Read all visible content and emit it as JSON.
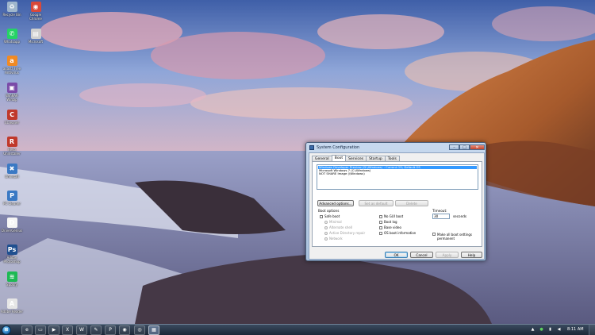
{
  "desktop": {
    "icons": [
      {
        "label": "Recycle Bin",
        "icon": "recycle-bin-icon",
        "glyph": "♻",
        "color": "#9fb6cc"
      },
      {
        "label": "Google Chrome",
        "icon": "chrome-icon",
        "glyph": "◉",
        "color": "#d9493a"
      },
      {
        "label": "Whatsapp",
        "icon": "whatsapp-icon",
        "glyph": "✆",
        "color": "#25d366"
      },
      {
        "label": "Microsoft",
        "icon": "document-icon",
        "glyph": "▤",
        "color": "#d0d0d0"
      },
      {
        "label": "avast! Free Antivirus",
        "icon": "avast-icon",
        "glyph": "a",
        "color": "#f08a24"
      },
      {
        "label": "WinRAR Winzip",
        "icon": "archive-icon",
        "glyph": "▣",
        "color": "#7a4ba8"
      },
      {
        "label": "CCleaner",
        "icon": "ccleaner-icon",
        "glyph": "C",
        "color": "#c0392b"
      },
      {
        "label": "Revo Uninstaller",
        "icon": "uninstaller-icon",
        "glyph": "R",
        "color": "#c0392b"
      },
      {
        "label": "Uninstall",
        "icon": "uninstall-icon",
        "glyph": "✖",
        "color": "#3a79c4"
      },
      {
        "label": "PC Cleaner",
        "icon": "cleaner-icon",
        "glyph": "P",
        "color": "#3a79c4"
      },
      {
        "label": "DriverGenius",
        "icon": "driver-icon",
        "glyph": "D",
        "color": "#f5f5f5"
      },
      {
        "label": "Adobe Photoshop",
        "icon": "photoshop-icon",
        "glyph": "Ps",
        "color": "#1f4f8f"
      },
      {
        "label": "Spotify",
        "icon": "spotify-icon",
        "glyph": "≋",
        "color": "#1db954"
      },
      {
        "label": "Adobe Reader",
        "icon": "pdf-icon",
        "glyph": "A",
        "color": "#e6e6e6"
      }
    ]
  },
  "dialog": {
    "title": "System Configuration",
    "caption": {
      "minimize": "–",
      "maximize": "□",
      "close": "✕"
    },
    "tabs": [
      "General",
      "Boot",
      "Services",
      "Startup",
      "Tools"
    ],
    "active_tab": "Boot",
    "os_list": [
      "Windows Developer Preview (D:\\Windows) : Current OS; Default OS",
      "Microsoft Windows 7 (C:\\Windows)",
      "NOT SHARE Image (\\Windows)"
    ],
    "buttons": {
      "advanced": "Advanced options...",
      "set_default": "Set as default",
      "delete": "Delete"
    },
    "boot_options": {
      "label": "Boot options",
      "safe_boot": "Safe boot",
      "minimal": "Minimal",
      "alternate_shell": "Alternate shell",
      "active_directory": "Active Directory repair",
      "network": "Network",
      "no_gui": "No GUI boot",
      "boot_log": "Boot log",
      "base_video": "Base video",
      "os_boot_info": "OS boot information"
    },
    "timeout": {
      "label": "Timeout:",
      "value": "30",
      "unit": "seconds",
      "permanent": "Make all boot settings permanent"
    },
    "footer": {
      "ok": "OK",
      "cancel": "Cancel",
      "apply": "Apply",
      "help": "Help"
    }
  },
  "taskbar": {
    "start": "⊞",
    "apps": [
      {
        "icon": "ie-icon",
        "glyph": "e"
      },
      {
        "icon": "explorer-icon",
        "glyph": "▭"
      },
      {
        "icon": "media-player-icon",
        "glyph": "▶"
      },
      {
        "icon": "excel-icon",
        "glyph": "X"
      },
      {
        "icon": "word-icon",
        "glyph": "W"
      },
      {
        "icon": "paint-icon",
        "glyph": "✎"
      },
      {
        "icon": "photoshop-icon",
        "glyph": "P"
      },
      {
        "icon": "chrome-icon",
        "glyph": "◉"
      },
      {
        "icon": "firefox-icon",
        "glyph": "◎"
      },
      {
        "icon": "system-config-icon",
        "glyph": "▦"
      }
    ],
    "clock": "8:11 AM"
  }
}
